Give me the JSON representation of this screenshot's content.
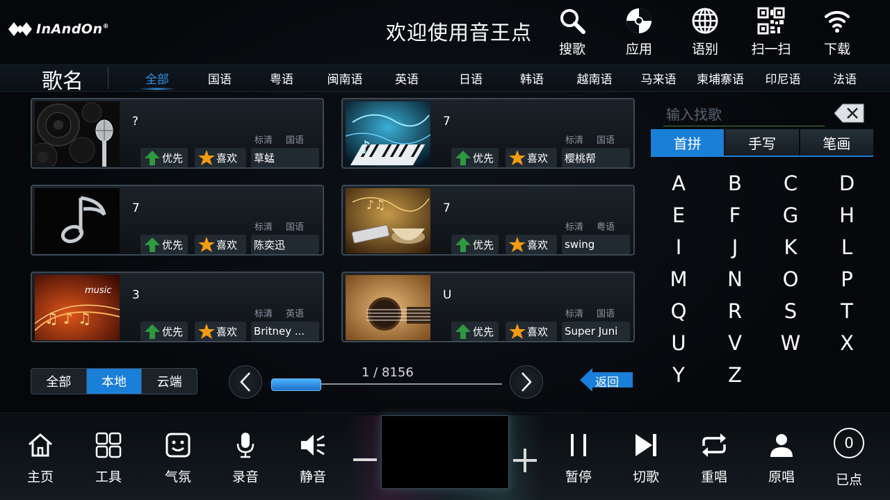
{
  "header": {
    "logo_text": "InAndOn",
    "logo_reg": "®",
    "welcome": "欢迎使用音王点",
    "buttons": [
      {
        "label": "搜歌",
        "icon": "search-icon"
      },
      {
        "label": "应用",
        "icon": "app-icon"
      },
      {
        "label": "语别",
        "icon": "globe-icon"
      },
      {
        "label": "扫一扫",
        "icon": "qr-code-icon"
      },
      {
        "label": "下载",
        "icon": "wifi-download-icon"
      }
    ]
  },
  "category_bar": {
    "title": "歌名",
    "tabs": [
      "全部",
      "国语",
      "粤语",
      "闽南语",
      "英语",
      "日语",
      "韩语",
      "越南语",
      "马来语",
      "柬埔寨语",
      "印尼语",
      "法语"
    ],
    "active_index": 0
  },
  "songs": [
    {
      "title": "?",
      "quality": "标清",
      "language": "国语",
      "priority": "优先",
      "favorite": "喜欢",
      "singer": "草蜢",
      "thumb": "speaker-microphone"
    },
    {
      "title": "7",
      "quality": "标清",
      "language": "国语",
      "priority": "优先",
      "favorite": "喜欢",
      "singer": "樱桃帮",
      "thumb": "keyboard-music"
    },
    {
      "title": "7",
      "quality": "标清",
      "language": "国语",
      "priority": "优先",
      "favorite": "喜欢",
      "singer": "陈奕迅",
      "thumb": "music-note"
    },
    {
      "title": "7",
      "quality": "标清",
      "language": "粤语",
      "priority": "优先",
      "favorite": "喜欢",
      "singer": "swing",
      "thumb": "harmonica-cup"
    },
    {
      "title": "3",
      "quality": "标清",
      "language": "英语",
      "priority": "优先",
      "favorite": "喜欢",
      "singer": "Britney ...",
      "thumb": "music-notes-orange"
    },
    {
      "title": "U",
      "quality": "标清",
      "language": "国语",
      "priority": "优先",
      "favorite": "喜欢",
      "singer": "Super Juni",
      "thumb": "guitar"
    }
  ],
  "source_filter": {
    "options": [
      "全部",
      "本地",
      "云端"
    ],
    "active_index": 1
  },
  "pagination": {
    "text": "1 / 8156",
    "current": 1,
    "total": 8156,
    "back_label": "返回"
  },
  "input_panel": {
    "search_placeholder": "输入找歌",
    "search_value": "",
    "tabs": [
      "首拼",
      "手写",
      "笔画"
    ],
    "active_tab": 0,
    "keys": [
      "A",
      "B",
      "C",
      "D",
      "E",
      "F",
      "G",
      "H",
      "I",
      "J",
      "K",
      "L",
      "M",
      "N",
      "O",
      "P",
      "Q",
      "R",
      "S",
      "T",
      "U",
      "V",
      "W",
      "X",
      "Y",
      "Z"
    ]
  },
  "toolbar": {
    "left": [
      {
        "label": "主页",
        "icon": "home-icon"
      },
      {
        "label": "工具",
        "icon": "tools-grid-icon"
      },
      {
        "label": "气氛",
        "icon": "atmosphere-face-icon"
      },
      {
        "label": "录音",
        "icon": "microphone-icon"
      },
      {
        "label": "静音",
        "icon": "mute-speaker-icon"
      }
    ],
    "right": [
      {
        "label": "暂停",
        "icon": "pause-icon"
      },
      {
        "label": "切歌",
        "icon": "next-track-icon"
      },
      {
        "label": "重唱",
        "icon": "repeat-icon"
      },
      {
        "label": "原唱",
        "icon": "singer-person-icon"
      },
      {
        "label": "已点",
        "icon": "selected-count-icon"
      }
    ],
    "selected_count": "0"
  },
  "colors": {
    "accent": "#1a7fd8",
    "active_text": "#2d95e8",
    "priority_arrow": "#2e9a3e",
    "favorite_star": "#f39c12"
  }
}
